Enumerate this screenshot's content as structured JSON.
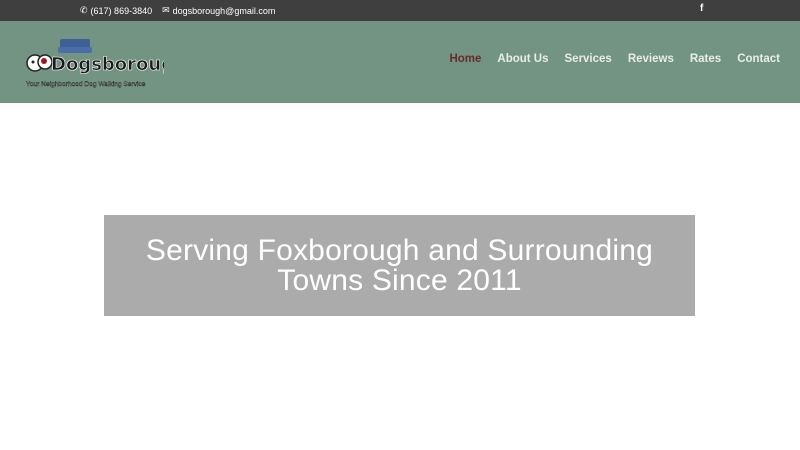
{
  "topbar": {
    "phone": "(617) 869-3840",
    "email": "dogsborough@gmail.com",
    "phone_icon": "phone-icon",
    "email_icon": "envelope-icon",
    "social_icon": "facebook-icon",
    "social_glyph": "f"
  },
  "logo": {
    "name": "Dogsborough",
    "tagline": "Your Neighborhood Dog Walking Service"
  },
  "nav": {
    "items": [
      "Home",
      "About Us",
      "Services",
      "Reviews",
      "Rates",
      "Contact"
    ]
  },
  "hero": {
    "title": "Serving Foxborough and Surrounding Towns Since 2011"
  },
  "colors": {
    "topbar": "#3f3f3f",
    "header": "#739483",
    "nav_active": "#6b2a2a",
    "hero_box": "#ababab"
  }
}
